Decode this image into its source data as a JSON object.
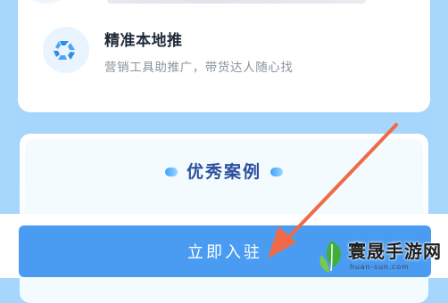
{
  "feature": {
    "title": "精准本地推",
    "description": "营销工具助推广，带货达人随心找"
  },
  "cases": {
    "title": "优秀案例"
  },
  "cta": {
    "label": "立即入驻"
  },
  "watermark": {
    "brand": "寰晟手游网",
    "url": "huan-sun.com"
  },
  "colors": {
    "accent": "#4a9cf2",
    "background": "#a6d6fb",
    "case_title": "#2c4fa0",
    "arrow": "#ef6b47"
  }
}
